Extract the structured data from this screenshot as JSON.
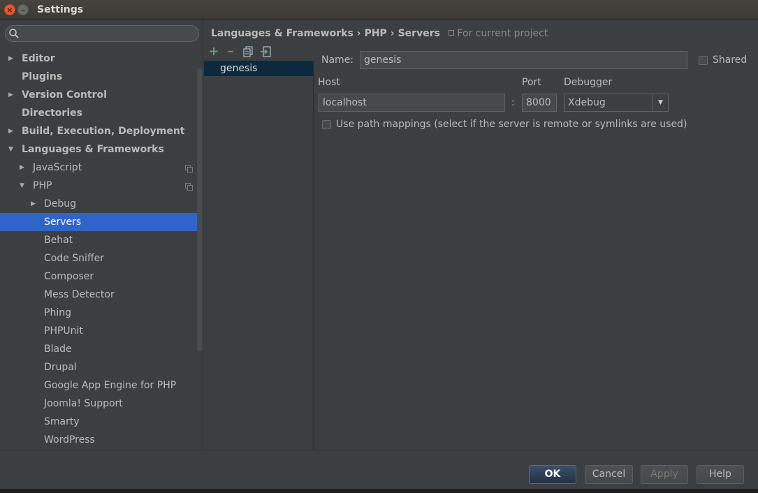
{
  "window": {
    "title": "Settings",
    "close_glyph": "×",
    "minimize_glyph": "–"
  },
  "search": {
    "placeholder": ""
  },
  "tree": [
    {
      "label": "Editor",
      "level": 0,
      "arrow": "right",
      "bold": true
    },
    {
      "label": "Plugins",
      "level": 0,
      "arrow": "none",
      "bold": true
    },
    {
      "label": "Version Control",
      "level": 0,
      "arrow": "right",
      "bold": true
    },
    {
      "label": "Directories",
      "level": 0,
      "arrow": "none",
      "bold": true
    },
    {
      "label": "Build, Execution, Deployment",
      "level": 0,
      "arrow": "right",
      "bold": true
    },
    {
      "label": "Languages & Frameworks",
      "level": 0,
      "arrow": "down",
      "bold": true
    },
    {
      "label": "JavaScript",
      "level": 1,
      "arrow": "right",
      "project": true
    },
    {
      "label": "PHP",
      "level": 1,
      "arrow": "down",
      "project": true
    },
    {
      "label": "Debug",
      "level": 2,
      "arrow": "right"
    },
    {
      "label": "Servers",
      "level": 2,
      "arrow": "none",
      "selected": true
    },
    {
      "label": "Behat",
      "level": 2,
      "arrow": "none"
    },
    {
      "label": "Code Sniffer",
      "level": 2,
      "arrow": "none"
    },
    {
      "label": "Composer",
      "level": 2,
      "arrow": "none"
    },
    {
      "label": "Mess Detector",
      "level": 2,
      "arrow": "none"
    },
    {
      "label": "Phing",
      "level": 2,
      "arrow": "none"
    },
    {
      "label": "PHPUnit",
      "level": 2,
      "arrow": "none"
    },
    {
      "label": "Blade",
      "level": 2,
      "arrow": "none"
    },
    {
      "label": "Drupal",
      "level": 2,
      "arrow": "none"
    },
    {
      "label": "Google App Engine for PHP",
      "level": 2,
      "arrow": "none"
    },
    {
      "label": "Joomla! Support",
      "level": 2,
      "arrow": "none"
    },
    {
      "label": "Smarty",
      "level": 2,
      "arrow": "none"
    },
    {
      "label": "WordPress",
      "level": 2,
      "arrow": "none"
    }
  ],
  "breadcrumb": {
    "parts": [
      "Languages & Frameworks",
      "PHP",
      "Servers"
    ],
    "separator": "›",
    "scope": "For current project"
  },
  "toolbar": {
    "add": "+",
    "remove": "–"
  },
  "servers": [
    {
      "name": "genesis"
    }
  ],
  "form": {
    "name_label": "Name:",
    "name_value": "genesis",
    "shared_label": "Shared",
    "host_label": "Host",
    "host_value": "localhost",
    "colon": ":",
    "port_label": "Port",
    "port_value": "8000",
    "debugger_label": "Debugger",
    "debugger_value": "Xdebug",
    "debugger_arrow": "▼",
    "path_mappings_label": "Use path mappings (select if the server is remote or symlinks are used)"
  },
  "buttons": {
    "ok": "OK",
    "cancel": "Cancel",
    "apply": "Apply",
    "help": "Help"
  },
  "colors": {
    "selection": "#2f65ca",
    "list_selection": "#0d293e",
    "background": "#3c3f41"
  }
}
